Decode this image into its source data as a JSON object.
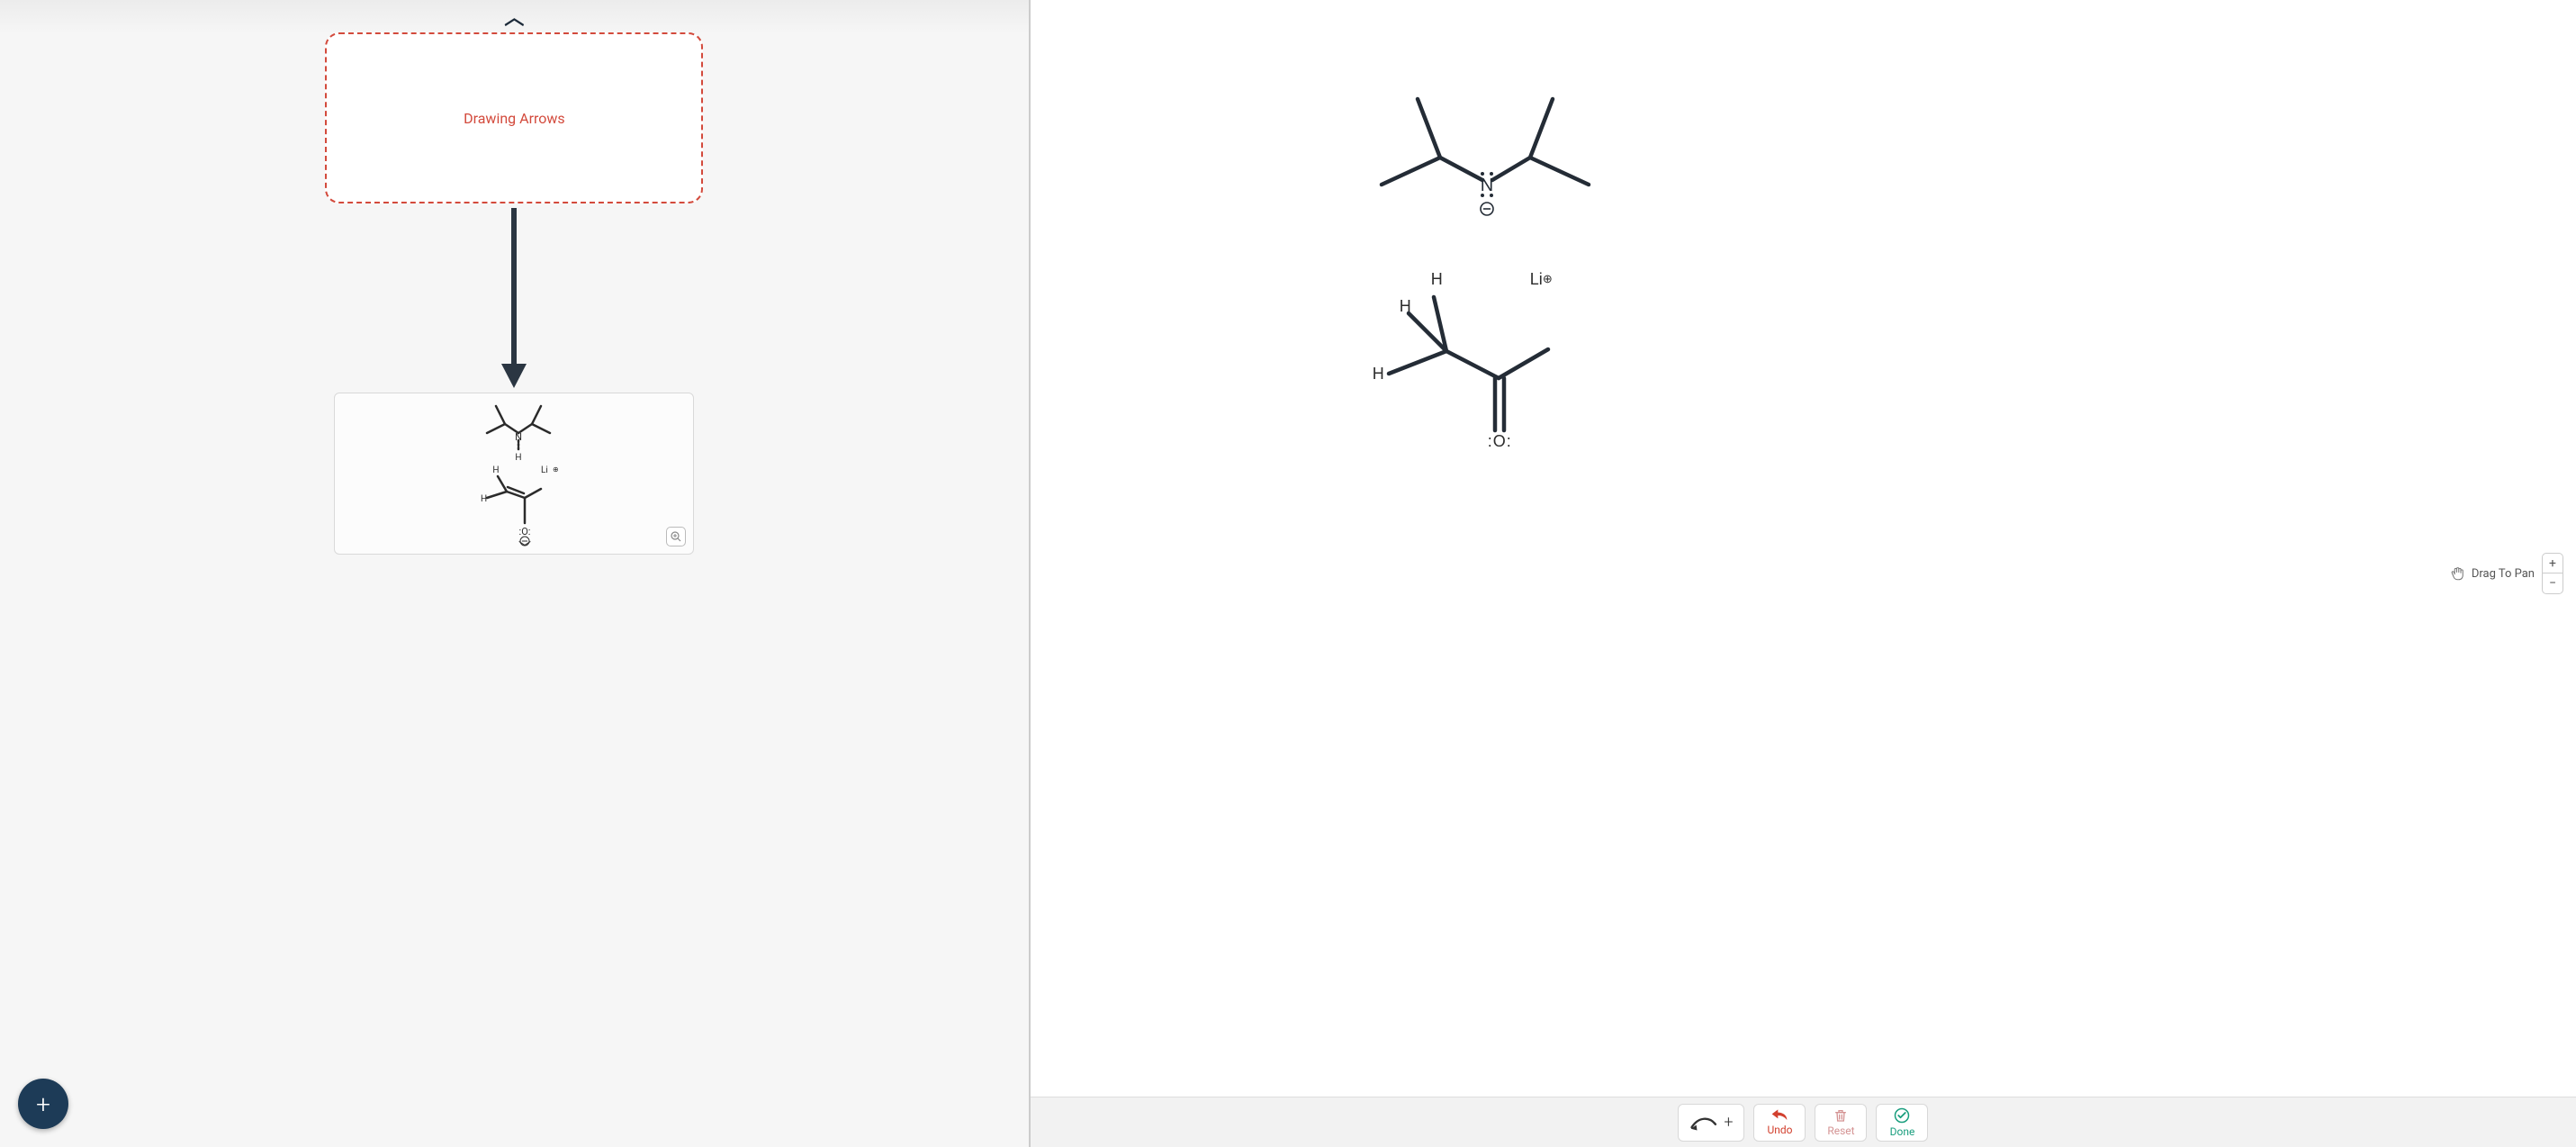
{
  "left": {
    "dashed_label": "Drawing Arrows",
    "thumb": {
      "atoms": {
        "N": "N",
        "H_top": "H",
        "H_center": "H",
        "H_left": "H",
        "Li": "Li",
        "O": "O"
      },
      "li_charge": "⊕",
      "n_charge": ""
    }
  },
  "canvas": {
    "top_mol": {
      "N": "N",
      "n_anion": "⊖"
    },
    "bot_mol": {
      "H1": "H",
      "H2": "H",
      "H3": "H",
      "Li": "Li",
      "O": "O",
      "li_charge": "⊕"
    }
  },
  "toolbar": {
    "undo": "Undo",
    "reset": "Reset",
    "done": "Done"
  },
  "pan": {
    "label": "Drag To Pan",
    "plus": "+",
    "minus": "−"
  },
  "fab": "+"
}
